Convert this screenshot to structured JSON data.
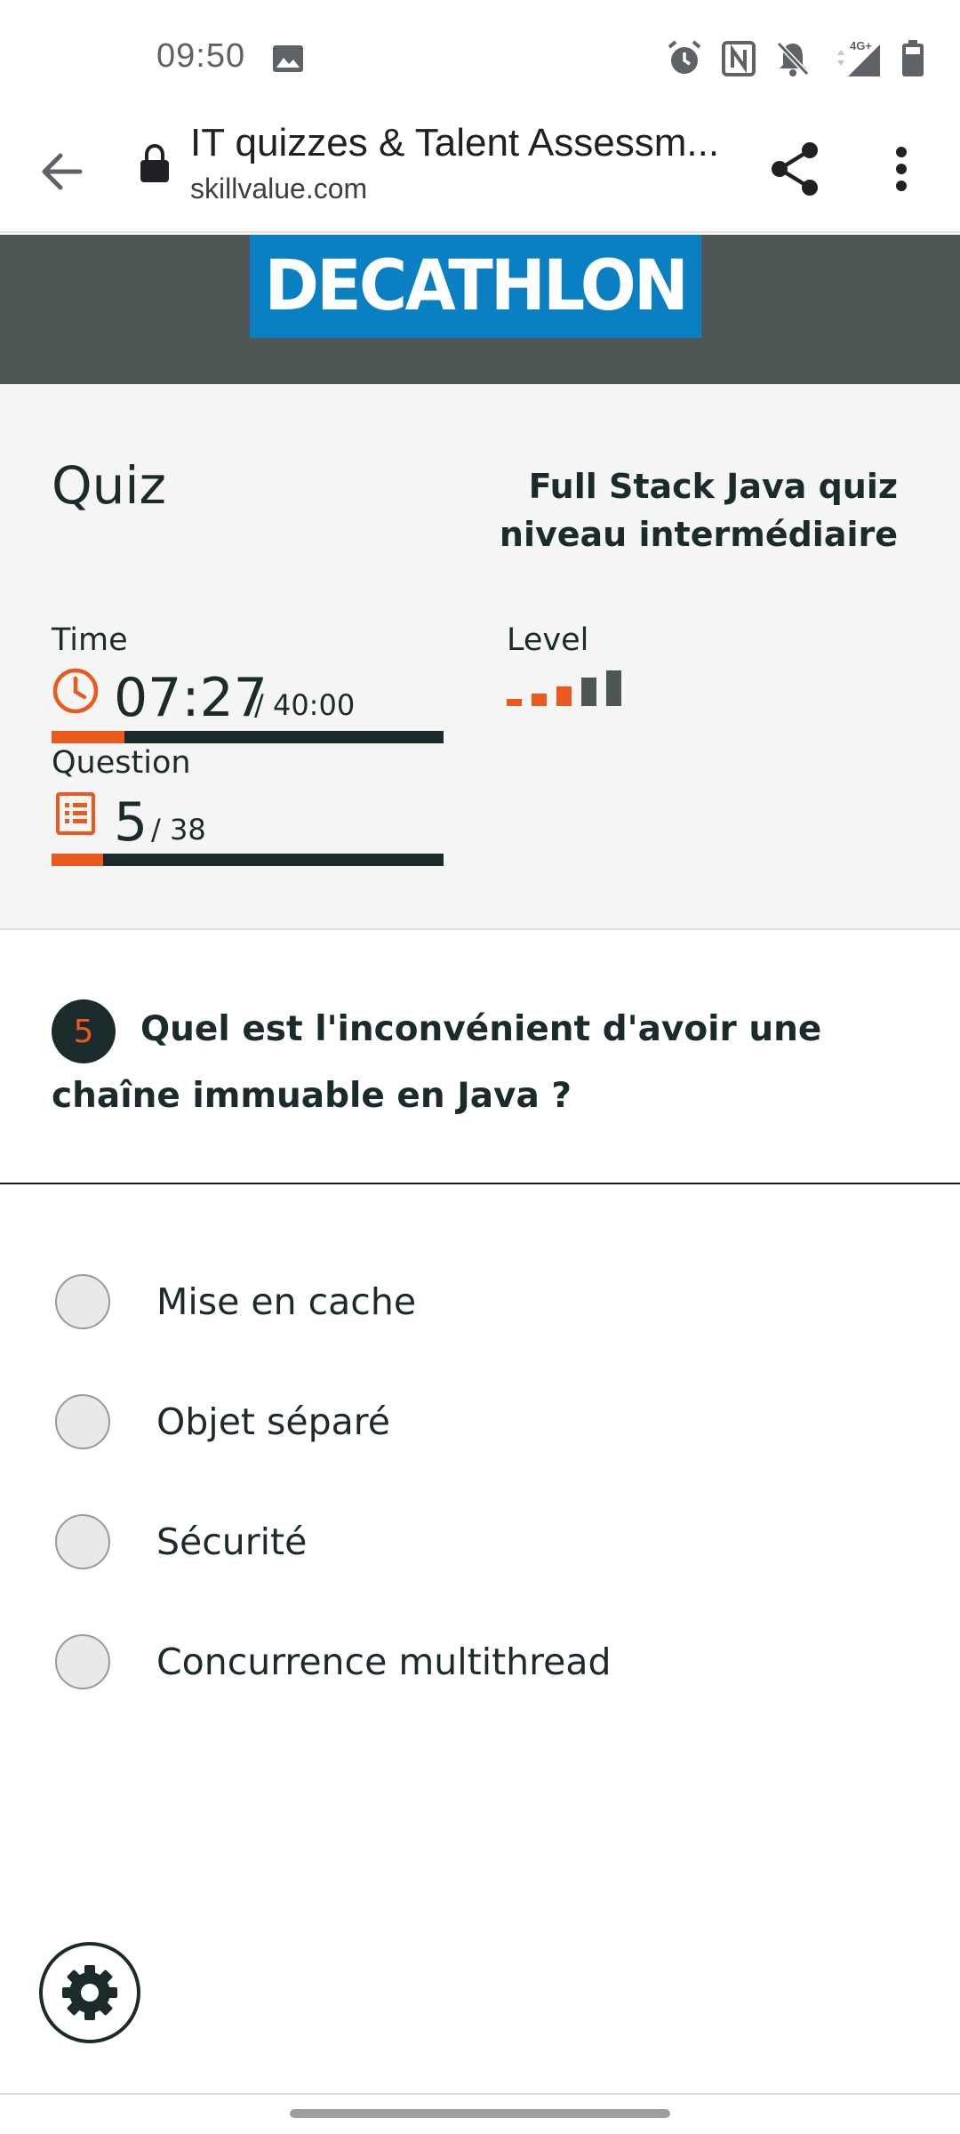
{
  "status_bar": {
    "time": "09:50",
    "icons": [
      "gallery-icon",
      "alarm-icon",
      "nfc-icon",
      "notifications-off-icon",
      "signal-4g-icon",
      "battery-icon"
    ],
    "network_label": "4G+"
  },
  "browser": {
    "page_title": "IT quizzes & Talent Assessm...",
    "domain": "skillvalue.com"
  },
  "brand": {
    "logo_text": "DECATHLON",
    "logo_color": "#0a7fc2",
    "band_color": "#4f5656"
  },
  "quiz": {
    "heading": "Quiz",
    "name": "Full Stack Java quiz niveau intermédiaire",
    "time_label": "Time",
    "time_elapsed": "07:27",
    "time_total": "/ 40:00",
    "time_progress": 0.186,
    "level_label": "Level",
    "level": 3,
    "level_max": 5,
    "question_label": "Question",
    "question_current": "5",
    "question_total": "/ 38",
    "question_progress": 0.132,
    "accent_color": "#ea5a1e"
  },
  "question": {
    "number": "5",
    "text": "Quel est l'inconvénient d'avoir une chaîne immuable en Java ?"
  },
  "answers": [
    {
      "label": "Mise en cache",
      "selected": false
    },
    {
      "label": "Objet séparé",
      "selected": false
    },
    {
      "label": "Sécurité",
      "selected": false
    },
    {
      "label": "Concurrence multithread",
      "selected": false
    }
  ]
}
